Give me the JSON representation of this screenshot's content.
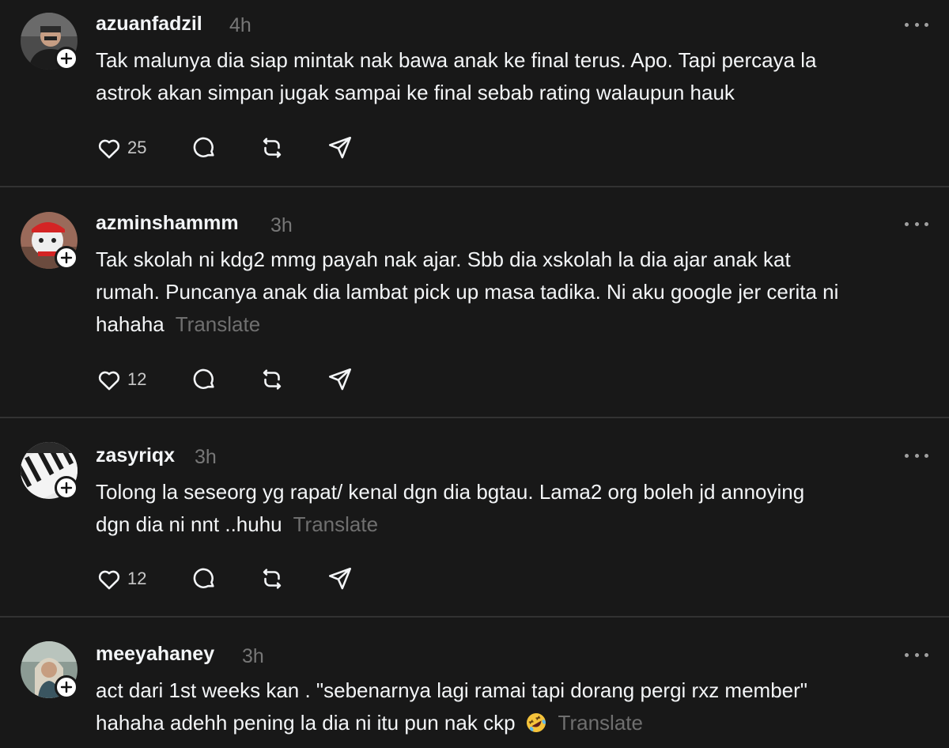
{
  "colors": {
    "background": "#181818",
    "text": "#f3f5f7",
    "muted": "#777777",
    "divider": "#323232"
  },
  "posts": [
    {
      "username": "azuanfadzil",
      "time": "4h",
      "lines": [
        "Tak malunya dia siap mintak nak bawa anak ke final terus. Apo. Tapi percaya la",
        "astrok akan simpan jugak sampai ke final sebab rating walaupun hauk"
      ],
      "likes": "25",
      "icons": [
        "heart-icon",
        "comment-icon",
        "repost-icon",
        "share-icon"
      ]
    },
    {
      "username": "azminshammm",
      "time": "3h",
      "lines": [
        "Tak skolah ni kdg2 mmg payah nak ajar. Sbb dia xskolah la dia ajar anak kat",
        "rumah. Puncanya anak dia lambat pick up masa tadika. Ni aku google jer cerita ni",
        "hahaha"
      ],
      "translate": "Translate",
      "likes": "12"
    },
    {
      "username": "zasyriqx",
      "time": "3h",
      "lines": [
        "Tolong la seseorg yg rapat/ kenal dgn dia bgtau. Lama2 org boleh jd annoying",
        "dgn dia ni nnt ..huhu"
      ],
      "translate": "Translate",
      "likes": "12"
    },
    {
      "username": "meeyahaney",
      "time": "3h",
      "lines": [
        "act dari 1st weeks kan . \"sebenarnya lagi ramai tapi dorang pergi rxz member\"",
        "hahaha adehh pening la dia ni itu pun nak ckp"
      ],
      "emoji": "rolling-on-floor-laughing-emoji",
      "translate": "Translate"
    }
  ]
}
